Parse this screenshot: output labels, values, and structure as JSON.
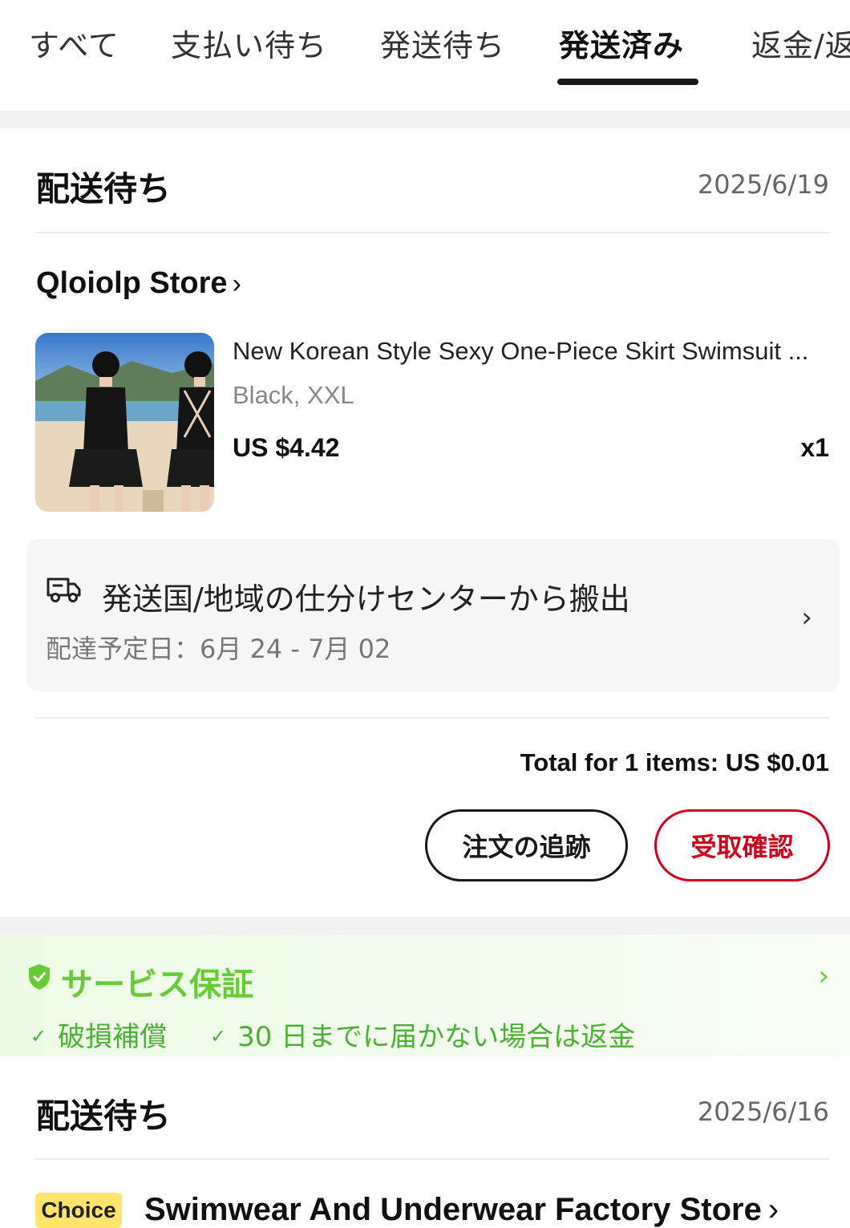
{
  "tabs": [
    {
      "label": "すべて"
    },
    {
      "label": "支払い待ち"
    },
    {
      "label": "発送待ち"
    },
    {
      "label": "発送済み",
      "active": true
    },
    {
      "label": "返金/返"
    }
  ],
  "orders": [
    {
      "status": "配送待ち",
      "date": "2025/6/19",
      "store": "Qloiolp Store",
      "product": {
        "title": "New Korean Style Sexy One-Piece Skirt Swimsuit ...",
        "variant": "Black, XXL",
        "price": "US $4.42",
        "qty": "x1"
      },
      "tracking": {
        "status": "発送国/地域の仕分けセンターから搬出",
        "eta": "配達予定日：6月 24 - 7月 02"
      },
      "total": "Total for 1 items: US $0.01",
      "buttons": {
        "track": "注文の追跡",
        "confirm": "受取確認"
      }
    },
    {
      "status": "配送待ち",
      "date": "2025/6/16",
      "badge": "Choice",
      "store": "Swimwear And Underwear Factory Store"
    }
  ],
  "service": {
    "title": "サービス保証",
    "items": [
      "破損補償",
      "30 日までに届かない場合は返金"
    ]
  },
  "colors": {
    "accent_red": "#d0021b",
    "service_green": "#66cc33",
    "choice_yellow": "#ffe46b"
  },
  "icons": [
    "chevron-right-icon",
    "truck-icon",
    "shield-check-icon",
    "check-icon"
  ]
}
